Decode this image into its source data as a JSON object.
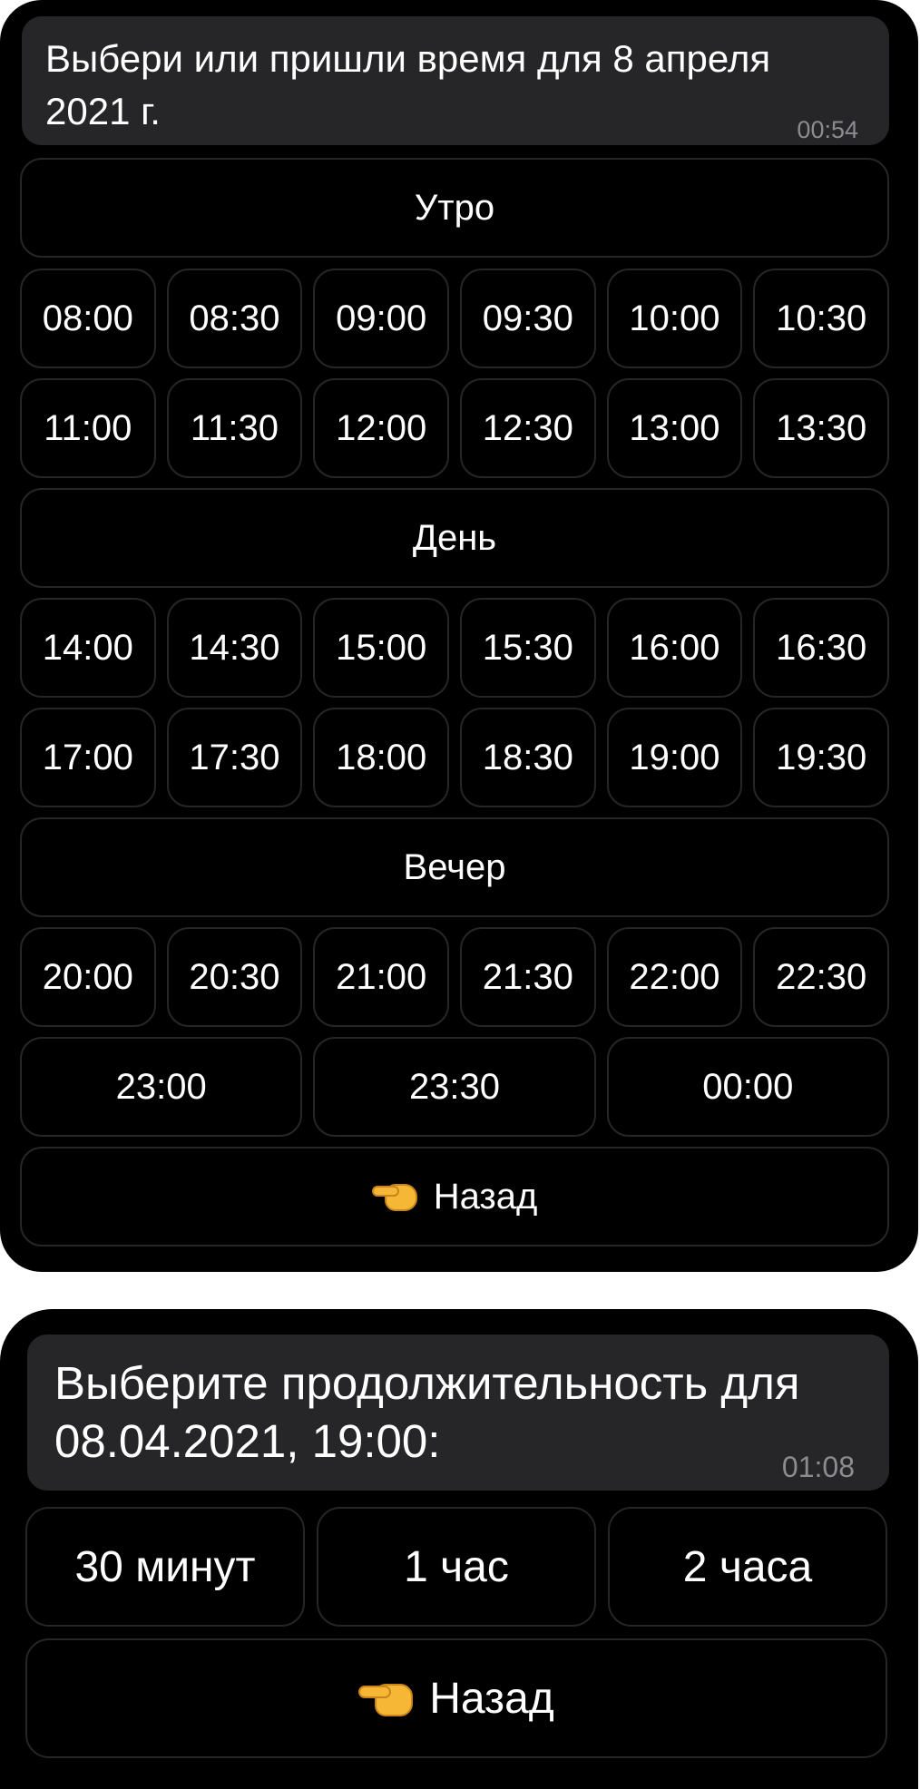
{
  "time_picker": {
    "message": {
      "text": "Выбери или пришли время для 8 апреля\n2021 г.",
      "time": "00:54"
    },
    "sections": {
      "morning": "Утро",
      "day": "День",
      "evening": "Вечер"
    },
    "slots": {
      "morning_row1": [
        "08:00",
        "08:30",
        "09:00",
        "09:30",
        "10:00",
        "10:30"
      ],
      "morning_row2": [
        "11:00",
        "11:30",
        "12:00",
        "12:30",
        "13:00",
        "13:30"
      ],
      "day_row1": [
        "14:00",
        "14:30",
        "15:00",
        "15:30",
        "16:00",
        "16:30"
      ],
      "day_row2": [
        "17:00",
        "17:30",
        "18:00",
        "18:30",
        "19:00",
        "19:30"
      ],
      "evening_row1": [
        "20:00",
        "20:30",
        "21:00",
        "21:30",
        "22:00",
        "22:30"
      ],
      "evening_row2": [
        "23:00",
        "23:30",
        "00:00"
      ]
    },
    "back_label": "Назад",
    "back_icon": "backhand-index-pointing-left-icon"
  },
  "duration_picker": {
    "message": {
      "text": "Выберите продолжительность для\n08.04.2021, 19:00:",
      "time": "01:08"
    },
    "options": [
      "30 минут",
      "1 час",
      "2 часа"
    ],
    "back_label": "Назад",
    "back_icon": "backhand-index-pointing-left-icon"
  }
}
